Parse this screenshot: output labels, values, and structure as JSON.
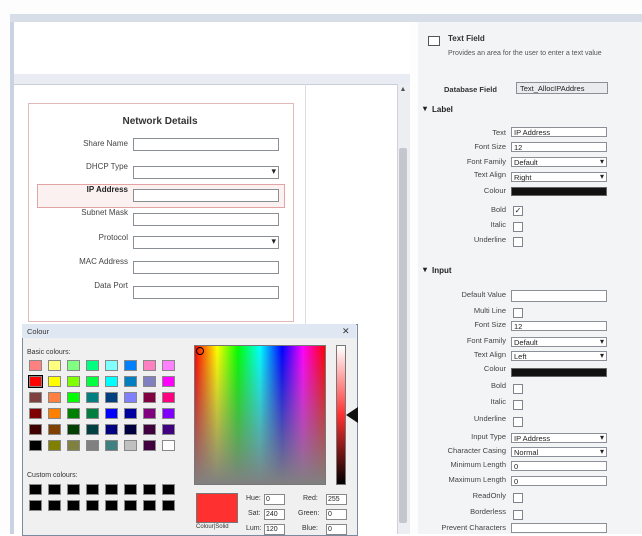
{
  "form": {
    "title": "Network Details",
    "fields": [
      {
        "label": "Share Name",
        "type": "text"
      },
      {
        "label": "DHCP Type",
        "type": "dropdown"
      },
      {
        "label": "IP Address",
        "type": "text"
      },
      {
        "label": "Subnet Mask",
        "type": "text"
      },
      {
        "label": "Protocol",
        "type": "dropdown"
      },
      {
        "label": "MAC Address",
        "type": "text"
      },
      {
        "label": "Data Port",
        "type": "text"
      }
    ]
  },
  "properties": {
    "component_name": "Text Field",
    "component_desc": "Provides an area for the user to enter a text value",
    "database_field_label": "Database Field",
    "database_field_value": "Text_AllocIPAddres",
    "label_section": {
      "title": "Label",
      "text_label": "Text",
      "text_value": "IP Address",
      "font_size_label": "Font Size",
      "font_size_value": "12",
      "font_family_label": "Font Family",
      "font_family_value": "Default",
      "text_align_label": "Text Align",
      "text_align_value": "Right",
      "colour_label": "Colour",
      "bold_label": "Bold",
      "bold_checked": "✓",
      "italic_label": "Italic",
      "underline_label": "Underline"
    },
    "input_section": {
      "title": "Input",
      "default_value_label": "Default Value",
      "multi_line_label": "Multi Line",
      "font_size_label": "Font Size",
      "font_size_value": "12",
      "font_family_label": "Font Family",
      "font_family_value": "Default",
      "text_align_label": "Text Align",
      "text_align_value": "Left",
      "colour_label": "Colour",
      "bold_label": "Bold",
      "italic_label": "Italic",
      "underline_label": "Underline",
      "input_type_label": "Input Type",
      "input_type_value": "IP Address",
      "character_casing_label": "Character Casing",
      "character_casing_value": "Normal",
      "minimum_length_label": "Minimum Length",
      "minimum_length_value": "0",
      "maximum_length_label": "Maximum Length",
      "maximum_length_value": "0",
      "readonly_label": "ReadOnly",
      "borderless_label": "Borderless",
      "prevent_characters_label": "Prevent Characters"
    }
  },
  "colour_dialog": {
    "title": "Colour",
    "close_glyph": "✕",
    "basic_colours_label": "Basic colours:",
    "custom_colours_label": "Custom colours:",
    "colour_solid_label": "Colour|Solid",
    "hue_label": "Hue:",
    "hue_value": "0",
    "sat_label": "Sat:",
    "sat_value": "240",
    "lum_label": "Lum:",
    "lum_value": "120",
    "red_label": "Red:",
    "red_value": "255",
    "green_label": "Green:",
    "green_value": "0",
    "blue_label": "Blue:",
    "blue_value": "0",
    "basic_colours": [
      "#ff8080",
      "#ffff80",
      "#80ff80",
      "#00ff80",
      "#80ffff",
      "#0080ff",
      "#ff80c0",
      "#ff80ff",
      "#ff0000",
      "#ffff00",
      "#80ff00",
      "#00ff40",
      "#00ffff",
      "#0080c0",
      "#8080c0",
      "#ff00ff",
      "#804040",
      "#ff8040",
      "#00ff00",
      "#008080",
      "#004080",
      "#8080ff",
      "#800040",
      "#ff0080",
      "#800000",
      "#ff8000",
      "#008000",
      "#008040",
      "#0000ff",
      "#0000a0",
      "#800080",
      "#8000ff",
      "#400000",
      "#804000",
      "#004000",
      "#004040",
      "#000080",
      "#000040",
      "#400040",
      "#400080",
      "#000000",
      "#808000",
      "#808040",
      "#808080",
      "#408080",
      "#c0c0c0",
      "#400040",
      "#ffffff"
    ],
    "selected_colour": "#ff3030"
  }
}
